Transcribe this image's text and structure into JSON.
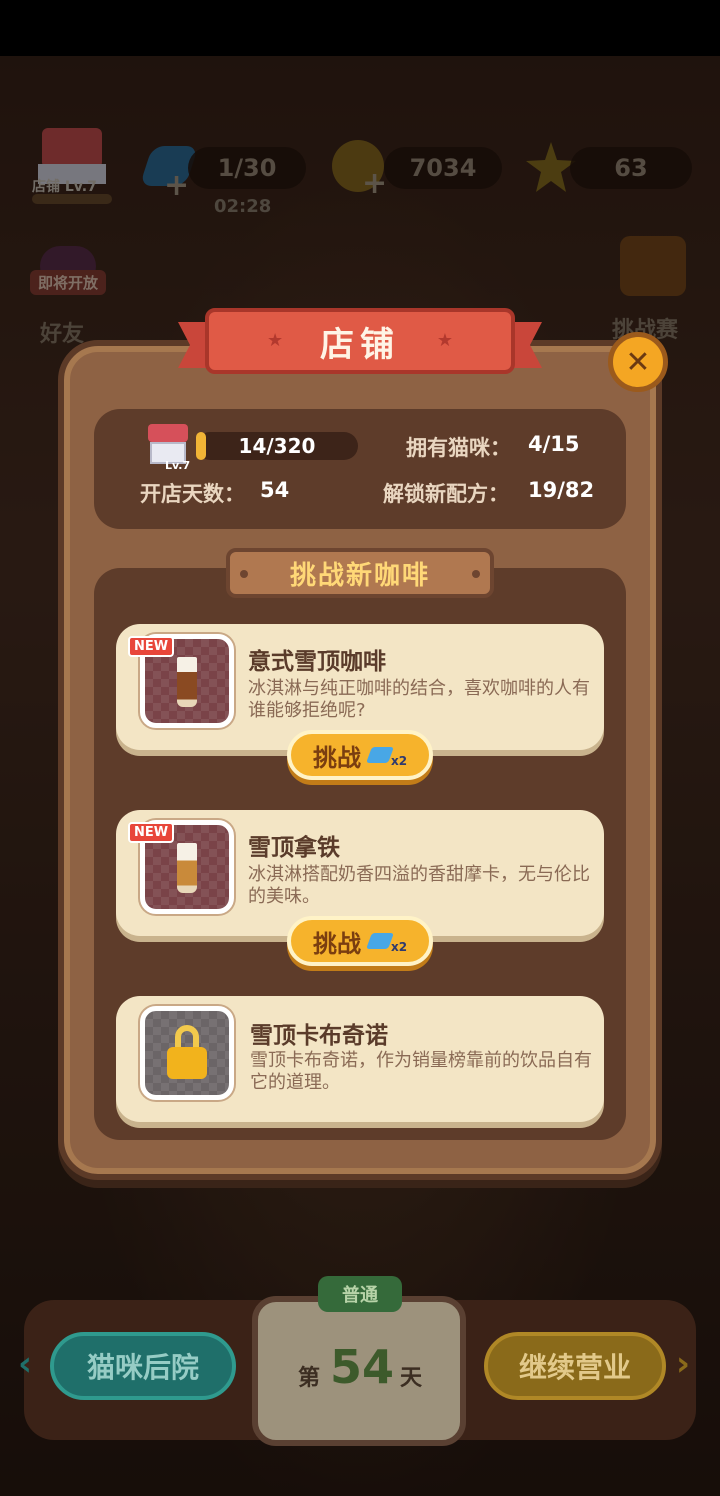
{
  "hud": {
    "shop_level": "店铺 Lv.7",
    "energy": "1/30",
    "energy_timer": "02:28",
    "coins": "7034",
    "stars": "63"
  },
  "side": {
    "coming_soon": "即将开放",
    "friends": "好友",
    "challenge": "挑战赛"
  },
  "modal": {
    "title": "店铺",
    "shop_level": "Lv.7",
    "progress": "14/320",
    "progress_fraction": 0.044,
    "cats_label": "拥有猫咪：",
    "cats_value": "4/15",
    "days_label": "开店天数：",
    "days_value": "54",
    "recipes_label": "解锁新配方：",
    "recipes_value": "19/82",
    "section_title": "挑战新咖啡",
    "items": [
      {
        "tag": "NEW",
        "name": "意式雪顶咖啡",
        "desc": "冰淇淋与纯正咖啡的结合，喜欢咖啡的人有谁能够拒绝呢?",
        "button": "挑战",
        "cost": "x2"
      },
      {
        "tag": "NEW",
        "name": "雪顶拿铁",
        "desc": "冰淇淋搭配奶香四溢的香甜摩卡，无与伦比的美味。",
        "button": "挑战",
        "cost": "x2"
      },
      {
        "name": "雪顶卡布奇诺",
        "desc": "雪顶卡布奇诺，作为销量榜靠前的饮品自有它的道理。"
      }
    ]
  },
  "bottom": {
    "backyard": "猫咪后院",
    "mode": "普通",
    "day_prefix": "第",
    "day_number": "54",
    "day_suffix": "天",
    "continue": "继续营业"
  },
  "colors": {
    "accent": "#f6b32c",
    "ribbon": "#e05a46",
    "panel": "#5e3c2a"
  }
}
